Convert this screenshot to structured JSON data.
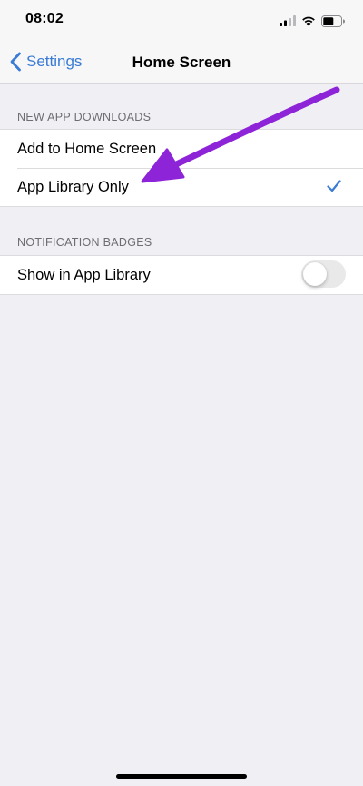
{
  "status_bar": {
    "time": "08:02"
  },
  "nav": {
    "back_label": "Settings",
    "title": "Home Screen"
  },
  "sections": {
    "new_app_downloads": {
      "header": "NEW APP DOWNLOADS",
      "items": [
        {
          "label": "Add to Home Screen",
          "selected": false
        },
        {
          "label": "App Library Only",
          "selected": true
        }
      ]
    },
    "notification_badges": {
      "header": "NOTIFICATION BADGES",
      "items": [
        {
          "label": "Show in App Library",
          "toggle_on": false
        }
      ]
    }
  },
  "colors": {
    "accent": "#3a7bd5",
    "annotation_arrow": "#8e24d8",
    "background": "#efeff4"
  },
  "icons": [
    "chevron-left-icon",
    "signal-icon",
    "wifi-icon",
    "battery-icon",
    "checkmark-icon"
  ]
}
